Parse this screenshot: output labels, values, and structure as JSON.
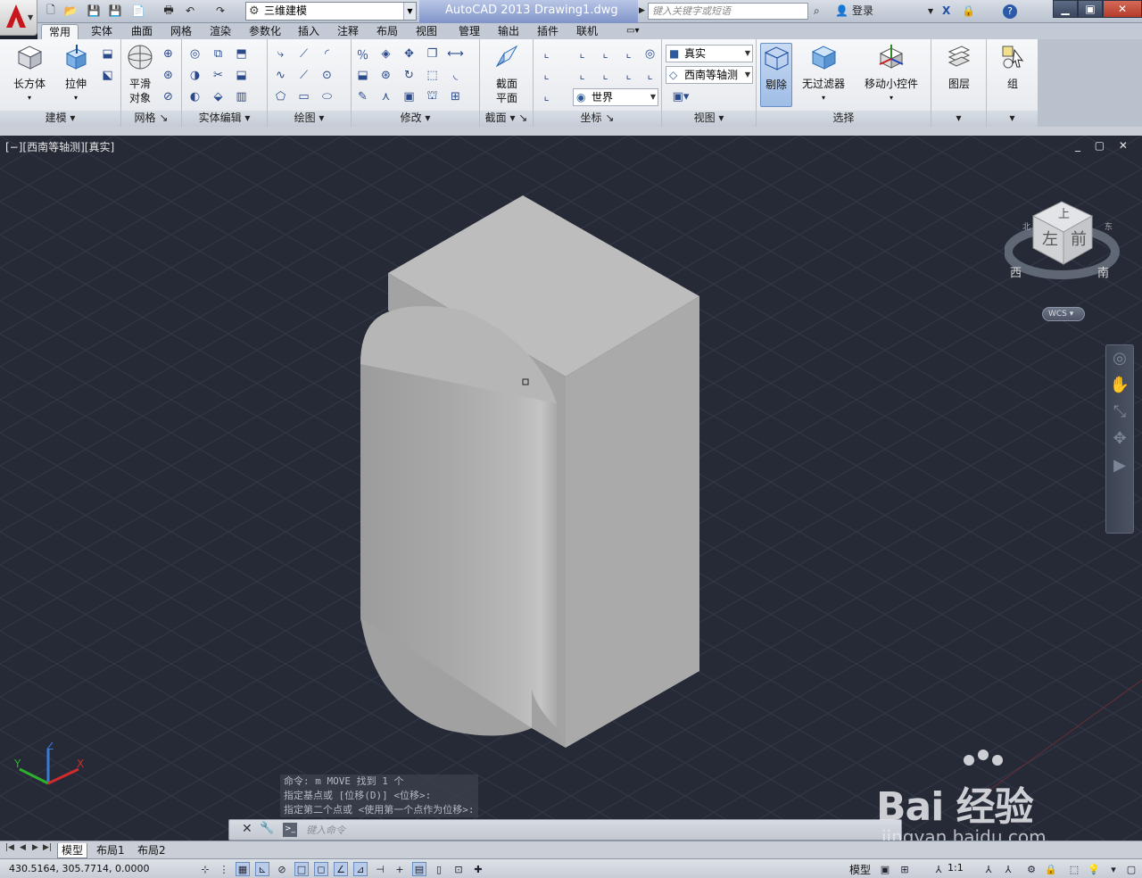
{
  "app": {
    "title": "AutoCAD 2013",
    "file": "Drawing1.dwg",
    "workspace": "三维建模",
    "search_placeholder": "键入关键字或短语",
    "login": "登录",
    "help": "?"
  },
  "tabs": [
    "常用",
    "实体",
    "曲面",
    "网格",
    "渲染",
    "参数化",
    "插入",
    "注释",
    "布局",
    "视图",
    "管理",
    "输出",
    "插件",
    "联机"
  ],
  "ribbon": {
    "modeling": {
      "title": "建模",
      "box": "长方体",
      "extrude": "拉伸"
    },
    "mesh": {
      "title": "网格",
      "smooth1": "平滑",
      "smooth2": "对象"
    },
    "solid_edit": {
      "title": "实体编辑"
    },
    "draw": {
      "title": "绘图"
    },
    "modify": {
      "title": "修改"
    },
    "section": {
      "title": "截面",
      "label1": "截面",
      "label2": "平面"
    },
    "coords": {
      "title": "坐标",
      "world": "世界"
    },
    "view": {
      "title": "视图",
      "visual_style": "真实",
      "view_name": "西南等轴测"
    },
    "selection": {
      "title": "选择",
      "cull": "剔除",
      "no_filter": "无过滤器",
      "gizmo": "移动小控件"
    },
    "layers": {
      "title": "图层"
    },
    "groups": {
      "title": "组"
    }
  },
  "viewport": {
    "label": "[−][西南等轴测][真实]",
    "controls": "_ ▢ ✕"
  },
  "viewcube": {
    "top": "上",
    "left": "左",
    "front": "前",
    "west": "西",
    "south": "南",
    "north": "北",
    "east": "东",
    "wcs": "WCS"
  },
  "command": {
    "history": [
      "命令: m MOVE 找到 1 个",
      "指定基点或 [位移(D)] <位移>:",
      "指定第二个点或 <使用第一个点作为位移>:"
    ],
    "placeholder": "键入命令"
  },
  "layout_tabs": [
    "模型",
    "布局1",
    "布局2"
  ],
  "status": {
    "coords": "430.5164, 305.7714, 0.0000",
    "model": "模型",
    "scale": "1:1"
  },
  "watermark": {
    "brand": "Bai 经验",
    "url": "jingyan.baidu.com"
  },
  "colors": {
    "viewport_bg": "#252a36",
    "accent": "#c8161d"
  }
}
